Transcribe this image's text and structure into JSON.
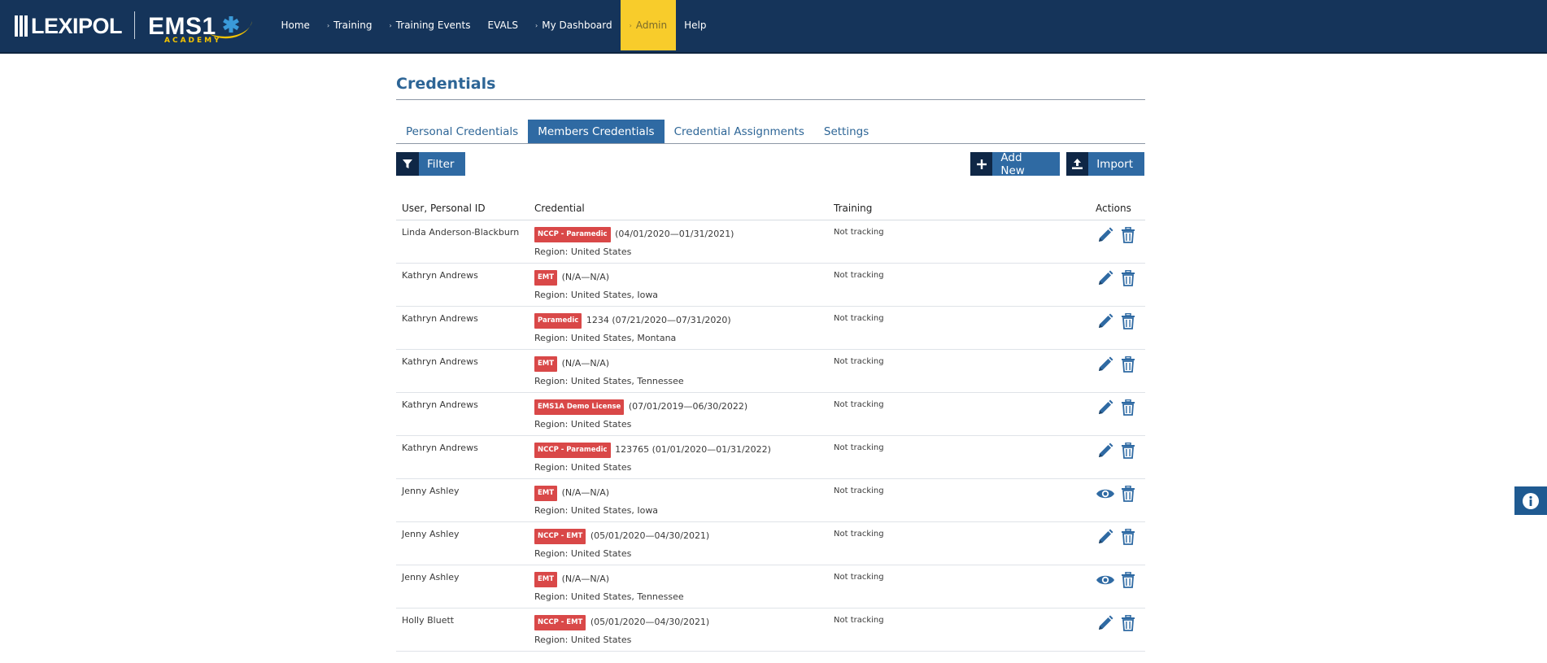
{
  "brand": {
    "lexipol": "LEXIPOL",
    "ems": "EMS1",
    "academy": "ACADEMY"
  },
  "colors": {
    "navbar": "#15345a",
    "accent": "#f8cc2b",
    "primary": "#2f6aa3",
    "badge": "#d94848"
  },
  "nav": [
    {
      "label": "Home",
      "caret": false,
      "active": false
    },
    {
      "label": "Training",
      "caret": true,
      "active": false
    },
    {
      "label": "Training Events",
      "caret": true,
      "active": false
    },
    {
      "label": "EVALS",
      "caret": false,
      "active": false
    },
    {
      "label": "My Dashboard",
      "caret": true,
      "active": false
    },
    {
      "label": "Admin",
      "caret": true,
      "active": true
    },
    {
      "label": "Help",
      "caret": false,
      "active": false
    }
  ],
  "page": {
    "title": "Credentials"
  },
  "tabs": [
    {
      "label": "Personal Credentials",
      "active": false
    },
    {
      "label": "Members Credentials",
      "active": true
    },
    {
      "label": "Credential Assignments",
      "active": false
    },
    {
      "label": "Settings",
      "active": false
    }
  ],
  "toolbar": {
    "filter_label": "Filter",
    "add_label": "Add New",
    "import_label": "Import",
    "icons": {
      "filter": "funnel-icon",
      "add": "plus-icon",
      "import": "upload-icon"
    }
  },
  "table": {
    "headers": {
      "user": "User, Personal ID",
      "credential": "Credential",
      "training": "Training",
      "actions": "Actions"
    },
    "rows": [
      {
        "user": "Linda Anderson-Blackburn",
        "badge": "NCCP - Paramedic",
        "detail": "(04/01/2020—01/31/2021)",
        "region": "Region: United States",
        "training": "Not tracking",
        "primary_action": "edit"
      },
      {
        "user": "Kathryn Andrews",
        "badge": "EMT",
        "detail": "(N/A—N/A)",
        "region": "Region: United States, Iowa",
        "training": "Not tracking",
        "primary_action": "edit"
      },
      {
        "user": "Kathryn Andrews",
        "badge": "Paramedic",
        "detail": "1234 (07/21/2020—07/31/2020)",
        "region": "Region: United States, Montana",
        "training": "Not tracking",
        "primary_action": "edit"
      },
      {
        "user": "Kathryn Andrews",
        "badge": "EMT",
        "detail": "(N/A—N/A)",
        "region": "Region: United States, Tennessee",
        "training": "Not tracking",
        "primary_action": "edit"
      },
      {
        "user": "Kathryn Andrews",
        "badge": "EMS1A Demo License",
        "detail": "(07/01/2019—06/30/2022)",
        "region": "Region: United States",
        "training": "Not tracking",
        "primary_action": "edit"
      },
      {
        "user": "Kathryn Andrews",
        "badge": "NCCP - Paramedic",
        "detail": "123765 (01/01/2020—01/31/2022)",
        "region": "Region: United States",
        "training": "Not tracking",
        "primary_action": "edit"
      },
      {
        "user": "Jenny Ashley",
        "badge": "EMT",
        "detail": "(N/A—N/A)",
        "region": "Region: United States, Iowa",
        "training": "Not tracking",
        "primary_action": "view"
      },
      {
        "user": "Jenny Ashley",
        "badge": "NCCP - EMT",
        "detail": "(05/01/2020—04/30/2021)",
        "region": "Region: United States",
        "training": "Not tracking",
        "primary_action": "edit"
      },
      {
        "user": "Jenny Ashley",
        "badge": "EMT",
        "detail": "(N/A—N/A)",
        "region": "Region: United States, Tennessee",
        "training": "Not tracking",
        "primary_action": "view"
      },
      {
        "user": "Holly Bluett",
        "badge": "NCCP - EMT",
        "detail": "(05/01/2020—04/30/2021)",
        "region": "Region: United States",
        "training": "Not tracking",
        "primary_action": "edit"
      }
    ]
  }
}
